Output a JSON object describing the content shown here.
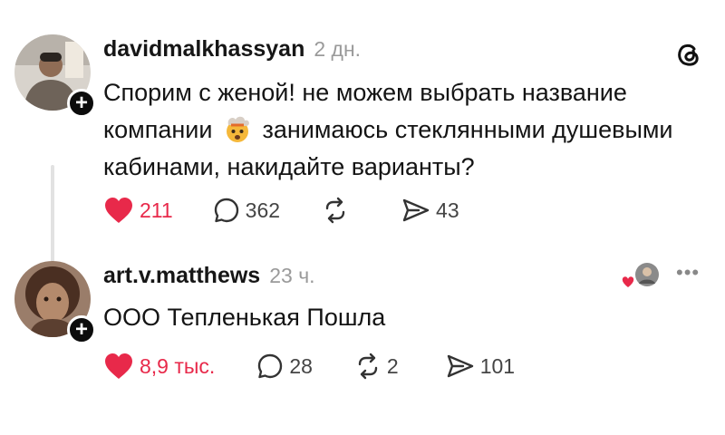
{
  "app": {
    "logo_icon": "threads-logo-icon",
    "accent_color": "#e8294a"
  },
  "posts": [
    {
      "username": "davidmalkhassyan",
      "time": "2 дн.",
      "text_part1": "Спорим с женой! не можем выбрать название компании",
      "emoji": "exploding-head-emoji",
      "text_part2": "занимаюсь стеклянными душевыми кабинами, накидайте варианты?",
      "likes": "211",
      "replies": "362",
      "reposts": "",
      "shares": "43",
      "liked": true
    },
    {
      "username": "art.v.matthews",
      "time": "23 ч.",
      "text": "ООО Тепленькая Пошла",
      "likes": "8,9 тыс.",
      "replies": "28",
      "reposts": "2",
      "shares": "101",
      "liked": true,
      "liked_by_author": true
    }
  ]
}
